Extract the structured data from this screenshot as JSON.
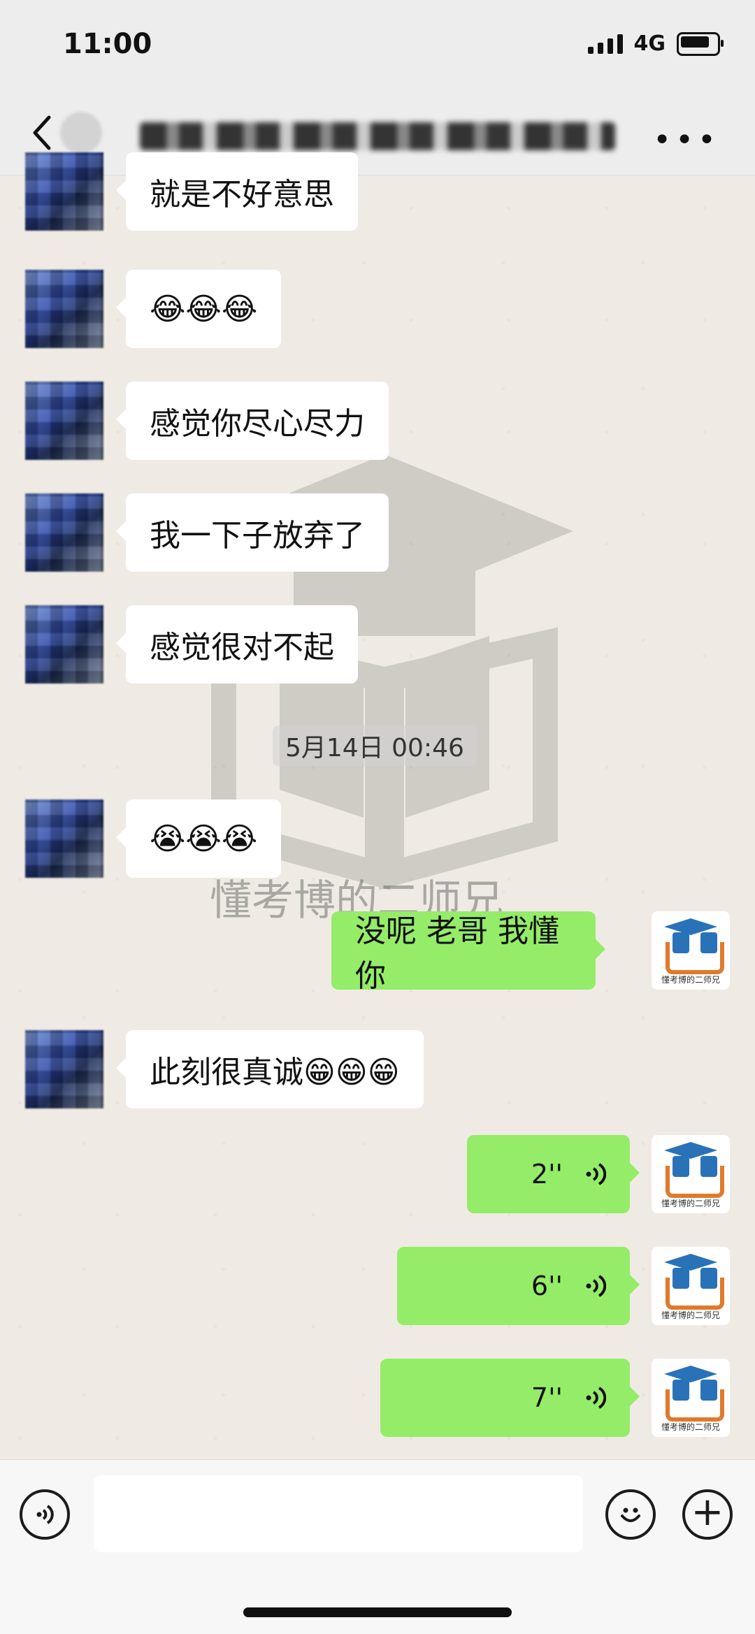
{
  "status": {
    "time": "11:00",
    "network": "4G"
  },
  "nav": {
    "title": "",
    "more_label": "•••"
  },
  "messages": [
    {
      "side": "left",
      "text": "就是不好意思"
    },
    {
      "side": "left",
      "text": "😂😂😂"
    },
    {
      "side": "left",
      "text": "感觉你尽心尽力"
    },
    {
      "side": "left",
      "text": "我一下子放弃了"
    },
    {
      "side": "left",
      "text": "感觉很对不起"
    },
    {
      "side": "left",
      "text": "😭😭😭"
    },
    {
      "side": "right",
      "text": "没呢 老哥 我懂你"
    },
    {
      "side": "left",
      "text": "此刻很真诚😁😁😁"
    },
    {
      "side": "right",
      "voice": "2''"
    },
    {
      "side": "right",
      "voice": "6''"
    },
    {
      "side": "right",
      "voice": "7''"
    }
  ],
  "timestamp": "5月14日 00:46",
  "watermark": "懂考博的二师兄",
  "avatar_caption": "懂考博的二师兄",
  "input": {
    "value": "",
    "placeholder": ""
  },
  "icons": {
    "back": "chevron-left-icon",
    "more": "more-icon",
    "voice": "voice-icon",
    "emoji": "emoji-icon",
    "plus": "plus-icon"
  },
  "colors": {
    "bubble_self": "#95ec69",
    "bubble_other": "#ffffff",
    "background": "#efebe4"
  }
}
